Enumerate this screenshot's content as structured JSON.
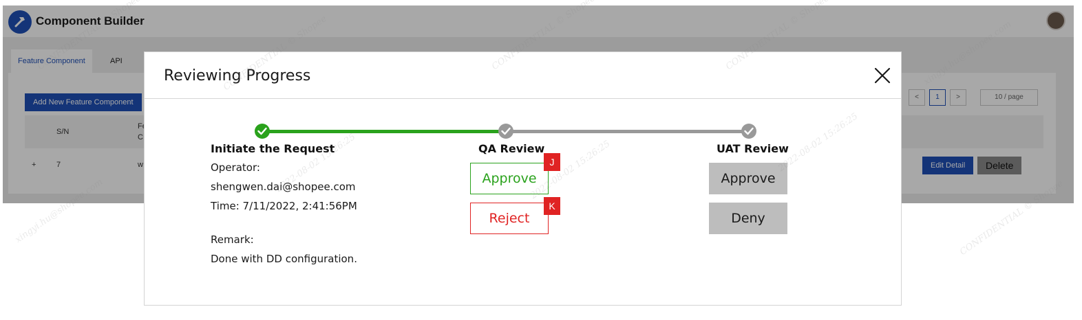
{
  "app": {
    "title": "Component Builder",
    "tabs": [
      {
        "label": "Feature Component",
        "active": true
      },
      {
        "label": "API",
        "active": false
      }
    ],
    "add_button": "Add New Feature Component",
    "table": {
      "headers": [
        "S/N",
        "Fe",
        "C"
      ],
      "row": {
        "expand": "+",
        "sn": "7",
        "feature": "w"
      }
    },
    "pagination": {
      "prev": "<",
      "current": "1",
      "next": ">",
      "page_size": "10 / page"
    },
    "row_actions": {
      "edit_detail": "Edit Detail",
      "delete": "Delete"
    }
  },
  "modal": {
    "title": "Reviewing Progress",
    "close_icon": "close-icon",
    "steps": [
      {
        "title": "Initiate the Request",
        "status": "done"
      },
      {
        "title": "QA Review",
        "status": "pending"
      },
      {
        "title": "UAT Review",
        "status": "pending"
      }
    ],
    "initiate": {
      "operator_label": "Operator:",
      "operator": "shengwen.dai@shopee.com",
      "time": "Time: 7/11/2022, 2:41:56PM",
      "remark_label": "Remark:",
      "remark": "Done with DD configuration."
    },
    "qa": {
      "approve": "Approve",
      "reject": "Reject",
      "approve_shortcut": "J",
      "reject_shortcut": "K"
    },
    "uat": {
      "approve": "Approve",
      "deny": "Deny"
    }
  },
  "colors": {
    "brand": "#1f4fb6",
    "success": "#2aa21c",
    "danger": "#e02323",
    "pending": "#999999",
    "button_grey": "#bdbdbd"
  },
  "watermark": {
    "email": "xingyi.hu@shopee.com",
    "stamp": "2022-08-02 15:26:25",
    "notice": "CONFIDENTIAL © Shopee"
  }
}
